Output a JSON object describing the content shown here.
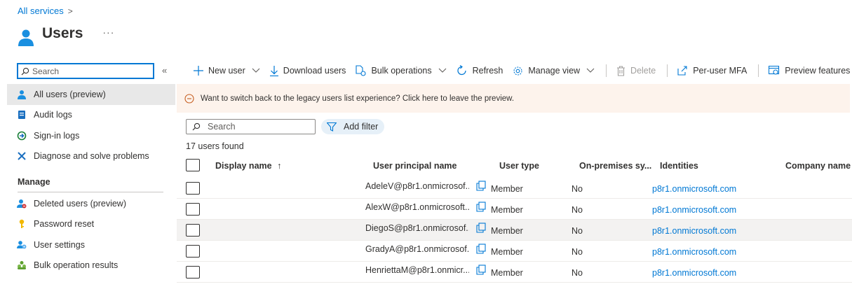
{
  "breadcrumb": {
    "parent": "All services",
    "separator": ">"
  },
  "header": {
    "title": "Users",
    "more": "···"
  },
  "sidebar": {
    "search_placeholder": "Search",
    "collapse": "«",
    "items": [
      {
        "label": "All users (preview)",
        "icon": "user-icon"
      },
      {
        "label": "Audit logs",
        "icon": "audit-log-icon"
      },
      {
        "label": "Sign-in logs",
        "icon": "sign-in-icon"
      },
      {
        "label": "Diagnose and solve problems",
        "icon": "wrench-icon"
      }
    ],
    "section_manage": "Manage",
    "manage_items": [
      {
        "label": "Deleted users (preview)",
        "icon": "deleted-user-icon"
      },
      {
        "label": "Password reset",
        "icon": "key-icon"
      },
      {
        "label": "User settings",
        "icon": "user-settings-icon"
      },
      {
        "label": "Bulk operation results",
        "icon": "group-icon"
      }
    ]
  },
  "toolbar": {
    "new_user": "New user",
    "download_users": "Download users",
    "bulk_operations": "Bulk operations",
    "refresh": "Refresh",
    "manage_view": "Manage view",
    "delete": "Delete",
    "per_user_mfa": "Per-user MFA",
    "preview_features": "Preview features"
  },
  "banner": {
    "text": "Want to switch back to the legacy users list experience? Click here to leave the preview."
  },
  "filter": {
    "search_placeholder": "Search",
    "add_filter": "Add filter"
  },
  "count_text": "17 users found",
  "table": {
    "columns": {
      "display_name": "Display name",
      "sort_indicator": "↑",
      "upn": "User principal name",
      "user_type": "User type",
      "on_prem": "On-premises sy...",
      "identities": "Identities",
      "company": "Company name"
    },
    "rows": [
      {
        "upn": "AdeleV@p8r1.onmicrosof...",
        "type": "Member",
        "onprem": "No",
        "identity": "p8r1.onmicrosoft.com"
      },
      {
        "upn": "AlexW@p8r1.onmicrosoft...",
        "type": "Member",
        "onprem": "No",
        "identity": "p8r1.onmicrosoft.com"
      },
      {
        "upn": "DiegoS@p8r1.onmicrosof...",
        "type": "Member",
        "onprem": "No",
        "identity": "p8r1.onmicrosoft.com"
      },
      {
        "upn": "GradyA@p8r1.onmicrosof...",
        "type": "Member",
        "onprem": "No",
        "identity": "p8r1.onmicrosoft.com"
      },
      {
        "upn": "HenriettaM@p8r1.onmicr...",
        "type": "Member",
        "onprem": "No",
        "identity": "p8r1.onmicrosoft.com"
      }
    ]
  },
  "colors": {
    "accent": "#0078d4",
    "banner_bg": "#fdf3ec",
    "selected_bg": "#e8e8e8"
  }
}
